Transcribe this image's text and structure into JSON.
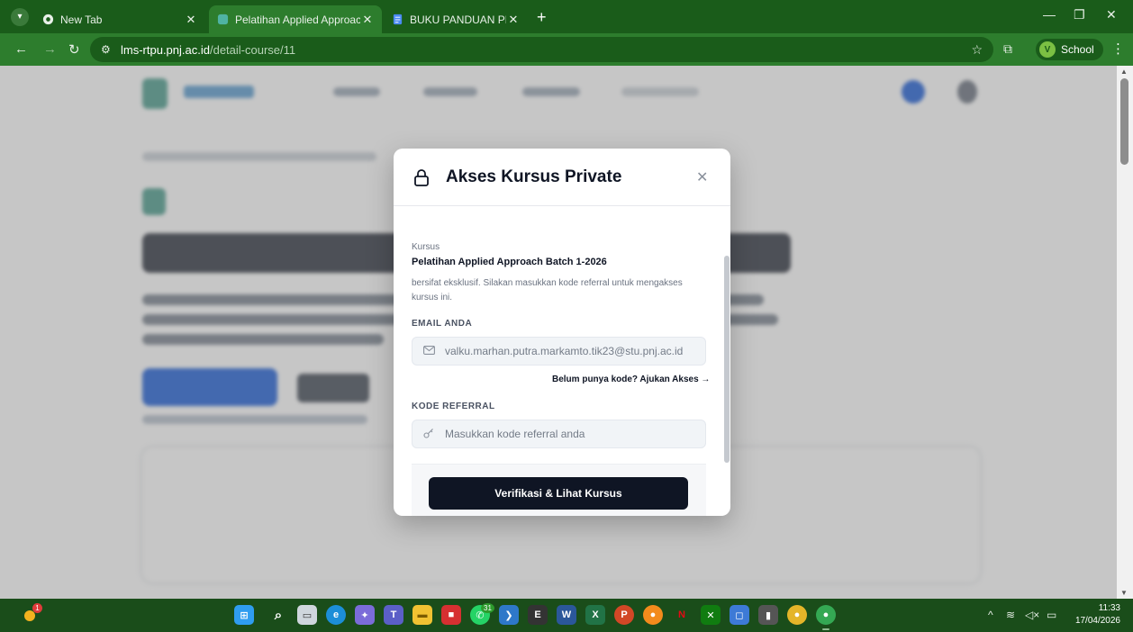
{
  "browser": {
    "tabs": [
      {
        "title": "New Tab",
        "favicon": "chrome-icon",
        "active": false
      },
      {
        "title": "Pelatihan Applied Approach Bat",
        "favicon": "lms-icon",
        "active": true
      },
      {
        "title": "BUKU PANDUAN PENGGUNA -",
        "favicon": "docs-icon",
        "active": false
      }
    ],
    "url_host": "lms-rtpu.pnj.ac.id",
    "url_path": "/detail-course/11",
    "profile_initial": "V",
    "profile_label": "School"
  },
  "modal": {
    "title": "Akses Kursus Private",
    "course_label": "Kursus",
    "course_name": "Pelatihan Applied Approach Batch 1-2026",
    "description": "bersifat eksklusif. Silakan masukkan kode referral untuk mengakses kursus ini.",
    "email_label": "EMAIL ANDA",
    "email_value": "valku.marhan.putra.markamto.tik23@stu.pnj.ac.id",
    "request_access_link": "Belum punya kode? Ajukan Akses →",
    "referral_label": "KODE REFERRAL",
    "referral_placeholder": "Masukkan kode referral anda",
    "verify_button": "Verifikasi & Lihat Kursus"
  },
  "taskbar": {
    "notification_count": "1",
    "chrome_badge_count": "31",
    "time": "11:33",
    "date": "17/04/2026"
  },
  "colors": {
    "browser_frame": "#1a5c1a",
    "browser_active": "#2d7d2d",
    "modal_primary": "#0f1524"
  }
}
